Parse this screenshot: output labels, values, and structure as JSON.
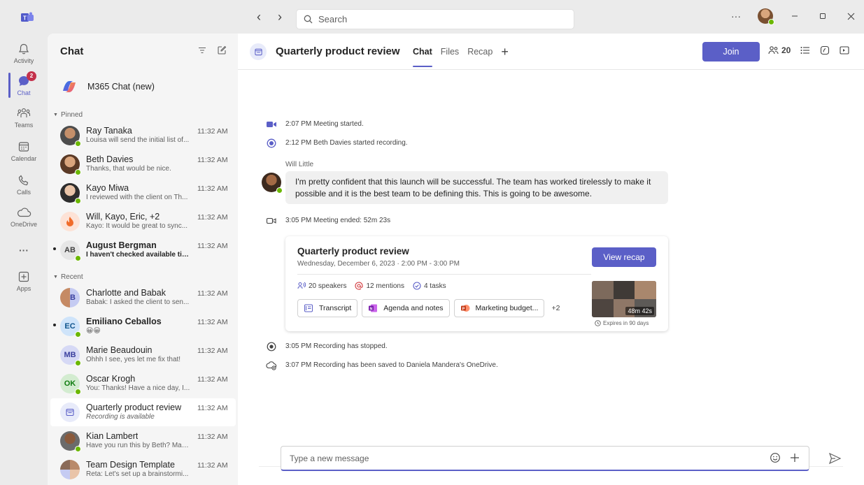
{
  "titlebar": {
    "search_placeholder": "Search",
    "more_label": "···"
  },
  "rail": {
    "items": [
      {
        "label": "Activity"
      },
      {
        "label": "Chat",
        "badge": "2"
      },
      {
        "label": "Teams"
      },
      {
        "label": "Calendar"
      },
      {
        "label": "Calls"
      },
      {
        "label": "OneDrive"
      },
      {
        "label": "···"
      },
      {
        "label": "Apps"
      }
    ]
  },
  "chatlist": {
    "title": "Chat",
    "copilot_label": "M365 Chat (new)",
    "pinned_label": "Pinned",
    "recent_label": "Recent",
    "pinned": [
      {
        "name": "Ray Tanaka",
        "preview": "Louisa will send the initial list of...",
        "time": "11:32 AM"
      },
      {
        "name": "Beth Davies",
        "preview": "Thanks, that would be nice.",
        "time": "11:32 AM"
      },
      {
        "name": "Kayo Miwa",
        "preview": "I reviewed with the client on Th...",
        "time": "11:32 AM"
      },
      {
        "name": "Will, Kayo, Eric, +2",
        "preview": "Kayo: It would be great to sync...",
        "time": "11:32 AM"
      },
      {
        "name": "August Bergman",
        "initials": "AB",
        "preview": "I haven't checked available tim...",
        "time": "11:32 AM"
      }
    ],
    "recent": [
      {
        "name": "Charlotte and Babak",
        "initials": "B",
        "preview": "Babak: I asked the client to sen...",
        "time": "11:32 AM"
      },
      {
        "name": "Emiliano Ceballos",
        "initials": "EC",
        "preview": "😀😀",
        "time": "11:32 AM"
      },
      {
        "name": "Marie Beaudouin",
        "initials": "MB",
        "preview": "Ohhh I see, yes let me fix that!",
        "time": "11:32 AM"
      },
      {
        "name": "Oscar Krogh",
        "initials": "OK",
        "preview": "You: Thanks! Have a nice day, I...",
        "time": "11:32 AM"
      },
      {
        "name": "Quarterly product review",
        "preview": "Recording is available",
        "time": "11:32 AM"
      },
      {
        "name": "Kian Lambert",
        "preview": "Have you run this by Beth? Mak...",
        "time": "11:32 AM"
      },
      {
        "name": "Team Design Template",
        "preview": "Reta: Let's set up a brainstormi...",
        "time": "11:32 AM"
      }
    ]
  },
  "main": {
    "title": "Quarterly product review",
    "tabs": [
      {
        "label": "Chat"
      },
      {
        "label": "Files"
      },
      {
        "label": "Recap"
      }
    ],
    "add_tab": "+",
    "join_label": "Join",
    "participant_count": "20",
    "events": {
      "started": "2:07 PM  Meeting started.",
      "recording": "2:12 PM  Beth Davies started recording.",
      "ended": "3:05 PM  Meeting ended: 52m 23s",
      "stopped": "3:05 PM  Recording has stopped.",
      "saved": "3:07 PM  Recording has been saved to Daniela Mandera's OneDrive."
    },
    "message": {
      "sender": "Will Little",
      "text": "I'm pretty confident that this launch will be successful. The team has worked tirelessly to make it possible and it is the best team to be defining this. This is going to be awesome."
    },
    "card": {
      "title": "Quarterly product review",
      "date": "Wednesday, December 6, 2023 · 2:00 PM - 3:00 PM",
      "recap_label": "View recap",
      "speakers": "20 speakers",
      "mentions": "12 mentions",
      "tasks": "4 tasks",
      "files": [
        {
          "label": "Transcript"
        },
        {
          "label": "Agenda and notes"
        },
        {
          "label": "Marketing budget..."
        }
      ],
      "more_files": "+2",
      "duration": "48m 42s",
      "expires": "Expires in 90 days"
    },
    "composer_placeholder": "Type a new message"
  },
  "colors": {
    "accent": "#5b5fc7",
    "presence": "#6bb700",
    "badge": "#c4314b"
  }
}
